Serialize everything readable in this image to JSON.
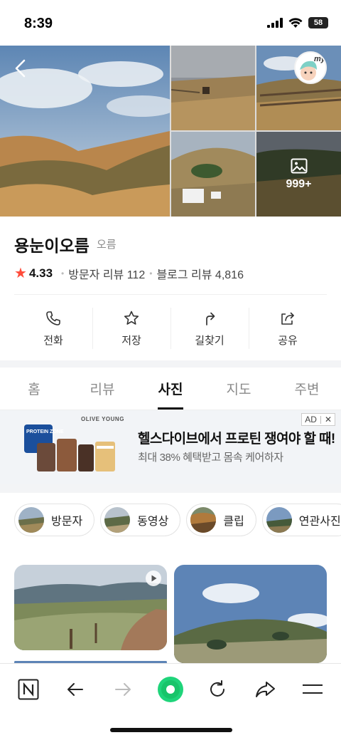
{
  "status_bar": {
    "time": "8:39",
    "battery": "58"
  },
  "gallery": {
    "more_count": "999+",
    "avatar_text": "my"
  },
  "place": {
    "name": "용눈이오름",
    "category": "오름",
    "rating": "4.33",
    "visitor_reviews": "방문자 리뷰 112",
    "blog_reviews": "블로그 리뷰 4,816"
  },
  "actions": [
    {
      "label": "전화",
      "icon": "phone-icon"
    },
    {
      "label": "저장",
      "icon": "star-icon"
    },
    {
      "label": "길찾기",
      "icon": "directions-icon"
    },
    {
      "label": "공유",
      "icon": "share-icon"
    }
  ],
  "tabs": [
    {
      "label": "홈",
      "active": false
    },
    {
      "label": "리뷰",
      "active": false
    },
    {
      "label": "사진",
      "active": true
    },
    {
      "label": "지도",
      "active": false
    },
    {
      "label": "주변",
      "active": false
    }
  ],
  "ad": {
    "brand": "OLIVE YOUNG",
    "headline": "헬스다이브에서 프로틴 쟁여야 할 때!",
    "sub": "최대 38% 혜택받고 몸속 케어하자",
    "badge": "AD",
    "close": "✕",
    "product_text": "PROTEIN ZONE"
  },
  "chips": [
    {
      "label": "방문자"
    },
    {
      "label": "동영상"
    },
    {
      "label": "클립"
    },
    {
      "label": "연관사진"
    }
  ],
  "colors": {
    "accent_green": "#03c75a",
    "star_red": "#ff4b3a"
  }
}
